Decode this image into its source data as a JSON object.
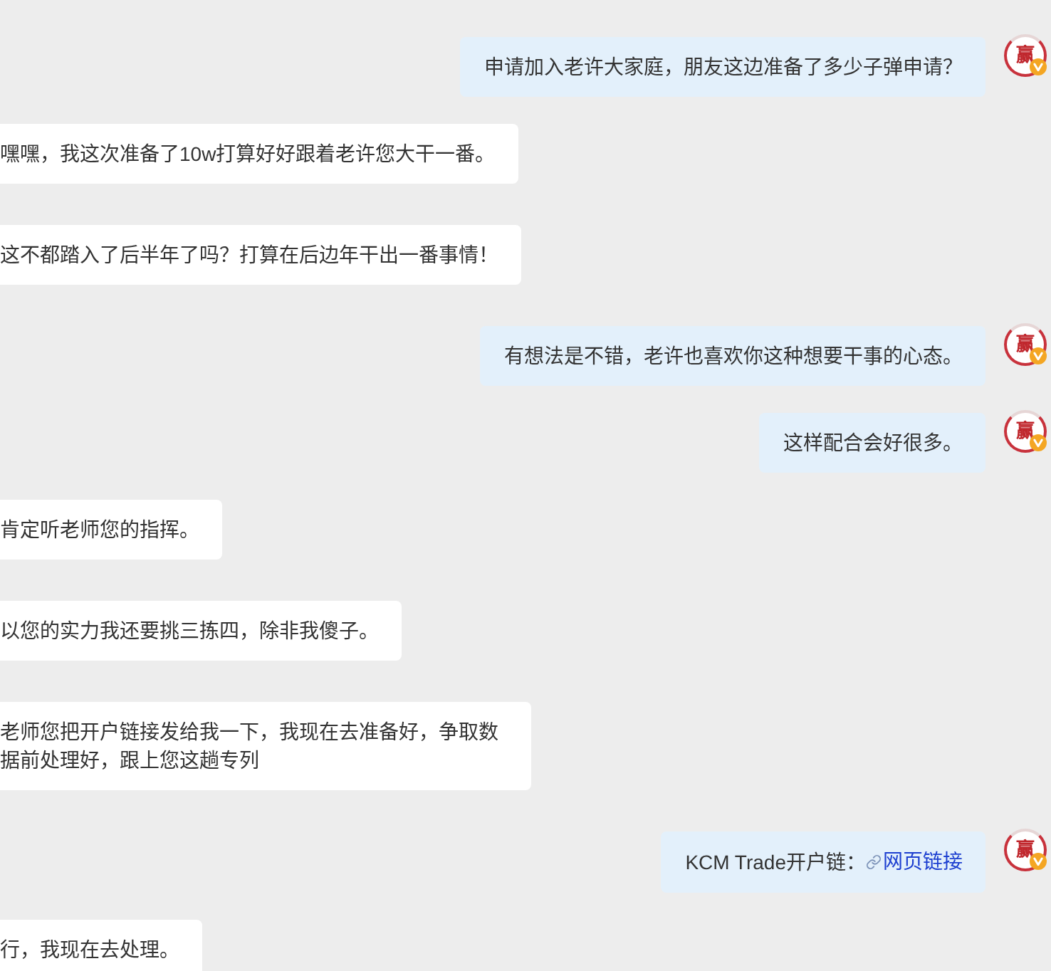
{
  "messages": [
    {
      "kind": "outgoing",
      "text": "申请加入老许大家庭，朋友这边准备了多少子弹申请？",
      "avatar": {
        "glyph": "赢",
        "verified": true
      }
    },
    {
      "kind": "incoming",
      "text": "嘿嘿，我这次准备了10w打算好好跟着老许您大干一番。"
    },
    {
      "kind": "incoming",
      "text": "这不都踏入了后半年了吗？打算在后边年干出一番事情！"
    },
    {
      "kind": "outgoing",
      "text": "有想法是不错，老许也喜欢你这种想要干事的心态。",
      "avatar": {
        "glyph": "赢",
        "verified": true
      }
    },
    {
      "kind": "outgoing",
      "text": "这样配合会好很多。",
      "avatar": {
        "glyph": "赢",
        "verified": true
      }
    },
    {
      "kind": "incoming",
      "text": "肯定听老师您的指挥。"
    },
    {
      "kind": "incoming",
      "text": "以您的实力我还要挑三拣四，除非我傻子。"
    },
    {
      "kind": "incoming",
      "text": "老师您把开户链接发给我一下，我现在去准备好，争取数据前处理好，跟上您这趟专列"
    },
    {
      "kind": "outgoing",
      "text": "KCM Trade开户链：",
      "link": {
        "label": "网页链接"
      },
      "avatar": {
        "glyph": "赢",
        "verified": true
      }
    },
    {
      "kind": "incoming",
      "text": "行，我现在去处理。"
    }
  ]
}
